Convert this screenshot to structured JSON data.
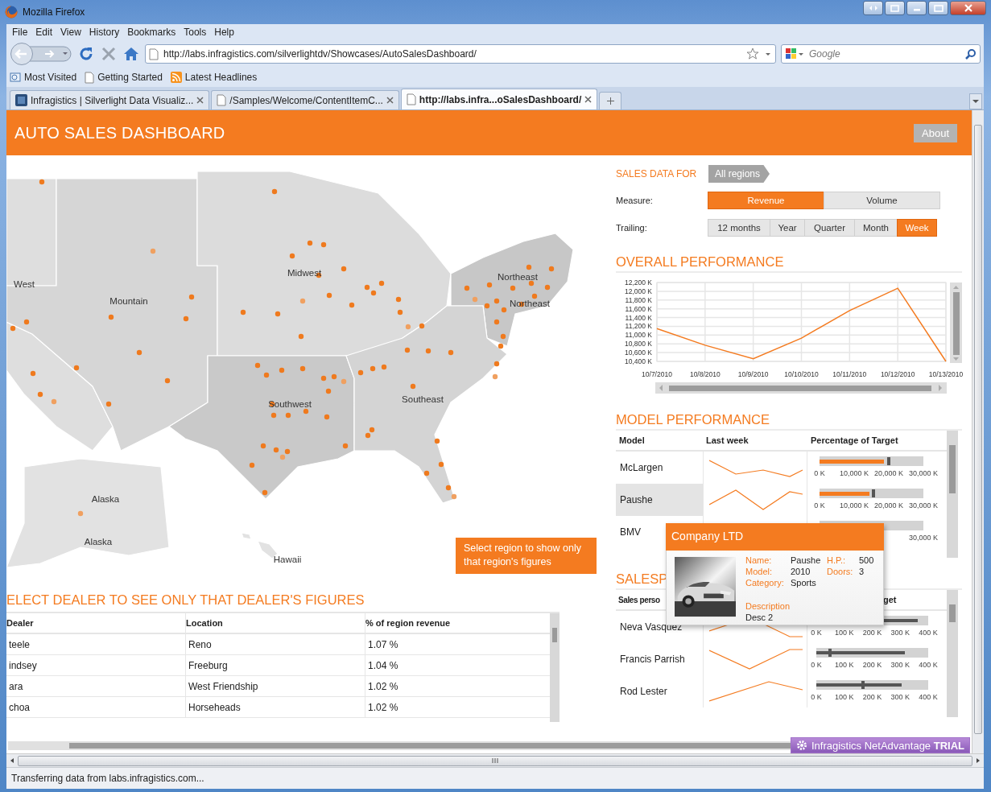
{
  "window": {
    "title": "Mozilla Firefox"
  },
  "menu": [
    "File",
    "Edit",
    "View",
    "History",
    "Bookmarks",
    "Tools",
    "Help"
  ],
  "address_bar": {
    "value": "http://labs.infragistics.com/silverlightdv/Showcases/AutoSalesDashboard/"
  },
  "search": {
    "placeholder": "Google"
  },
  "bookmarks": [
    {
      "label": "Most Visited",
      "kind": "folder"
    },
    {
      "label": "Getting Started",
      "kind": "page"
    },
    {
      "label": "Latest Headlines",
      "kind": "feed"
    }
  ],
  "tabs": [
    {
      "label": "Infragistics | Silverlight Data Visualiz...",
      "selected": false,
      "kind": "site"
    },
    {
      "label": "/Samples/Welcome/ContentItemC...",
      "selected": false,
      "kind": "page"
    },
    {
      "label": "http://labs.infra...oSalesDashboard/",
      "selected": true,
      "kind": "page"
    }
  ],
  "app": {
    "title": "AUTO SALES DASHBOARD",
    "about_button": "About"
  },
  "map": {
    "labels": [
      "West",
      "Mountain",
      "Midwest",
      "Northeast",
      "Northeast",
      "Southwest",
      "Southeast",
      "Alaska",
      "Alaska",
      "Hawaii"
    ],
    "hint": "Select region to show only that region's figures"
  },
  "dealers": {
    "title": "ELECT DEALER TO SEE ONLY THAT DEALER'S FIGURES",
    "columns": [
      "Dealer",
      "Location",
      "% of region revenue"
    ],
    "rows": [
      [
        "teele",
        "Reno",
        "1.07 %"
      ],
      [
        "indsey",
        "Freeburg",
        "1.04 %"
      ],
      [
        "ara",
        "West Friendship",
        "1.02 %"
      ],
      [
        "choa",
        "Horseheads",
        "1.02 %"
      ]
    ]
  },
  "sales_filter": {
    "label": "SALES DATA FOR",
    "region": "All regions",
    "measure_label": "Measure:",
    "measures": [
      {
        "label": "Revenue",
        "selected": true
      },
      {
        "label": "Volume",
        "selected": false
      }
    ],
    "trailing_label": "Trailing:",
    "periods": [
      {
        "label": "12 months",
        "selected": false
      },
      {
        "label": "Year",
        "selected": false
      },
      {
        "label": "Quarter",
        "selected": false
      },
      {
        "label": "Month",
        "selected": false
      },
      {
        "label": "Week",
        "selected": true
      }
    ]
  },
  "overall_performance": {
    "title": "OVERALL PERFORMANCE",
    "chart_data": {
      "type": "line",
      "categories": [
        "10/7/2010",
        "10/8/2010",
        "10/9/2010",
        "10/10/2010",
        "10/11/2010",
        "10/12/2010",
        "10/13/2010"
      ],
      "grid": true,
      "series": [
        {
          "color": "#f47b20",
          "values": [
            11150,
            10770,
            10460,
            10930,
            11560,
            12070,
            10400
          ]
        }
      ],
      "ylim": [
        10400,
        12200
      ],
      "yticks": [
        {
          "value": 10400,
          "label": "10,400 K"
        },
        {
          "value": 10600,
          "label": "10,600 K"
        },
        {
          "value": 10800,
          "label": "10,800 K"
        },
        {
          "value": 11000,
          "label": "11,000 K"
        },
        {
          "value": 11200,
          "label": "11,200 K"
        },
        {
          "value": 11400,
          "label": "11,400 K"
        },
        {
          "value": 11600,
          "label": "11,600 K"
        },
        {
          "value": 11800,
          "label": "11,800 K"
        },
        {
          "value": 12000,
          "label": "12,000 K"
        },
        {
          "value": 12200,
          "label": "12,200 K"
        }
      ]
    }
  },
  "model_performance": {
    "title": "MODEL PERFORMANCE",
    "columns": [
      "Model",
      "Last week",
      "Percentage of Target"
    ],
    "rows": [
      {
        "name": "McLargen",
        "selected": false,
        "bar": {
          "level": 0.62
        },
        "target": {
          "level": 0.67
        },
        "ticks": [
          "0 K",
          "10,000 K",
          "20,000 K",
          "30,000 K"
        ]
      },
      {
        "name": "Paushe",
        "selected": true,
        "bar": {
          "level": 0.48
        },
        "target": {
          "level": 0.52
        },
        "ticks": [
          "0 K",
          "10,000 K",
          "20,000 K",
          "30,000 K"
        ]
      },
      {
        "name": "BMV",
        "selected": false,
        "ticks": [
          "30,000 K"
        ]
      }
    ]
  },
  "salespeople": {
    "title": "SALESP",
    "columns": [
      "Sales perso",
      "get"
    ],
    "rows": [
      {
        "name": "Neva Vasquez",
        "bar": {
          "level": 0.91
        },
        "ticks": [
          "0 K",
          "100 K",
          "200 K",
          "300 K",
          "400 K"
        ]
      },
      {
        "name": "Francis Parrish",
        "bar": {
          "level": 0.79
        },
        "target": {
          "level": 0.12
        },
        "ticks": [
          "0 K",
          "100 K",
          "200 K",
          "300 K",
          "400 K"
        ]
      },
      {
        "name": "Rod Lester",
        "bar": {
          "level": 0.76
        },
        "target": {
          "level": 0.42
        },
        "ticks": [
          "0 K",
          "100 K",
          "200 K",
          "300 K",
          "400 K"
        ]
      }
    ]
  },
  "tooltip": {
    "title": "Company LTD",
    "fields": [
      {
        "label": "Name:",
        "value": "Paushe"
      },
      {
        "label": "Model:",
        "value": "2010"
      },
      {
        "label": "Category:",
        "value": "Sports"
      }
    ],
    "side_fields": [
      {
        "label": "H.P.:",
        "value": "500"
      },
      {
        "label": "Doors:",
        "value": "3"
      }
    ],
    "description_label": "Description",
    "description": "Desc 2"
  },
  "trial_badge": "Infragistics NetAdvantage **TRIAL**",
  "status_bar": "Transferring data from labs.infragistics.com..."
}
